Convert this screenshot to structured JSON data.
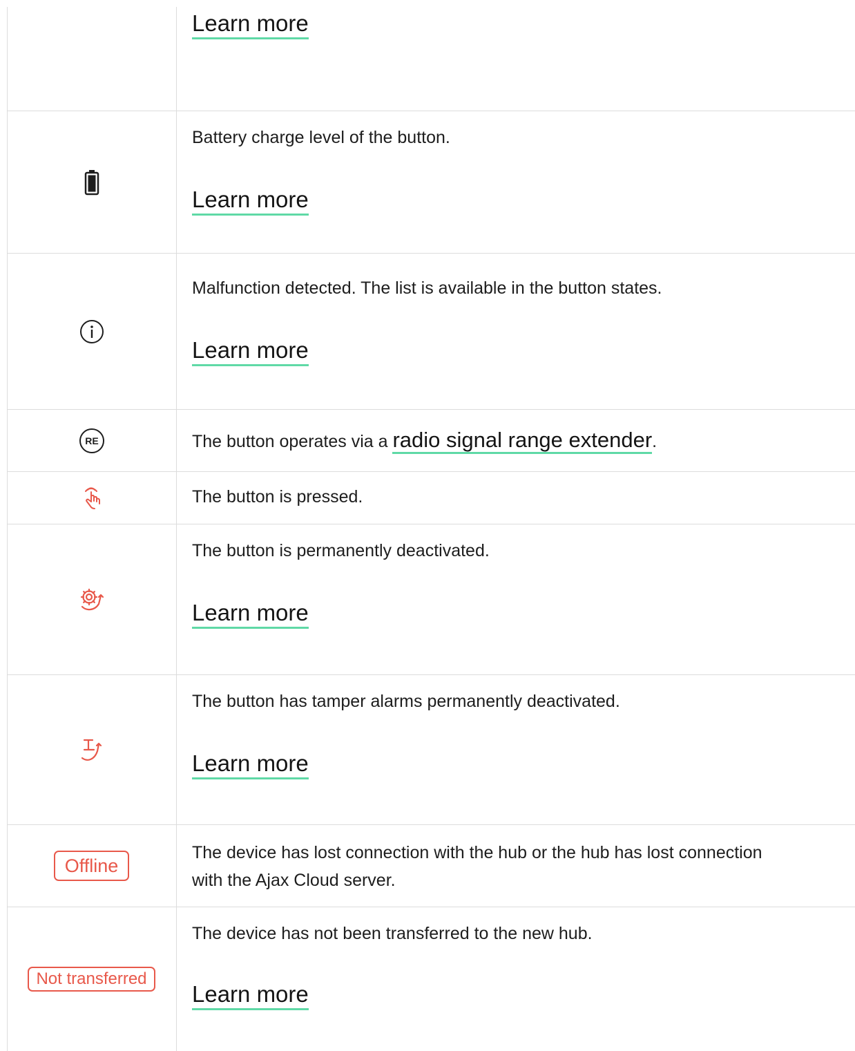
{
  "rows": [
    {
      "link": "Learn more"
    },
    {
      "icon": "battery-icon",
      "description": "Battery charge level of the button.",
      "link": "Learn more"
    },
    {
      "icon": "info-icon",
      "description": "Malfunction detected. The list is available in the button states.",
      "link": "Learn more"
    },
    {
      "icon": "range-extender-icon",
      "icon_text": "RE",
      "description_before": "The button operates via a ",
      "link": "radio signal range extender",
      "description_after": "."
    },
    {
      "icon": "hand-pressed-icon",
      "description": "The button is pressed."
    },
    {
      "icon": "gear-deactivated-icon",
      "description": "The button is permanently deactivated.",
      "link": "Learn more"
    },
    {
      "icon": "tamper-deactivated-icon",
      "description": "The button has tamper alarms permanently deactivated.",
      "link": "Learn more"
    },
    {
      "badge": "Offline",
      "description_line1": "The device has lost connection with the hub or the hub has lost connection",
      "description_line2": "with the Ajax Cloud server."
    },
    {
      "badge": "Not transferred",
      "description": "The device has not been transferred to the new hub.",
      "link": "Learn more"
    }
  ],
  "colors": {
    "accent_underline": "#5fd9a6",
    "alert": "#e8584a",
    "border": "#dcdcdc",
    "text": "#1d1d1d"
  }
}
